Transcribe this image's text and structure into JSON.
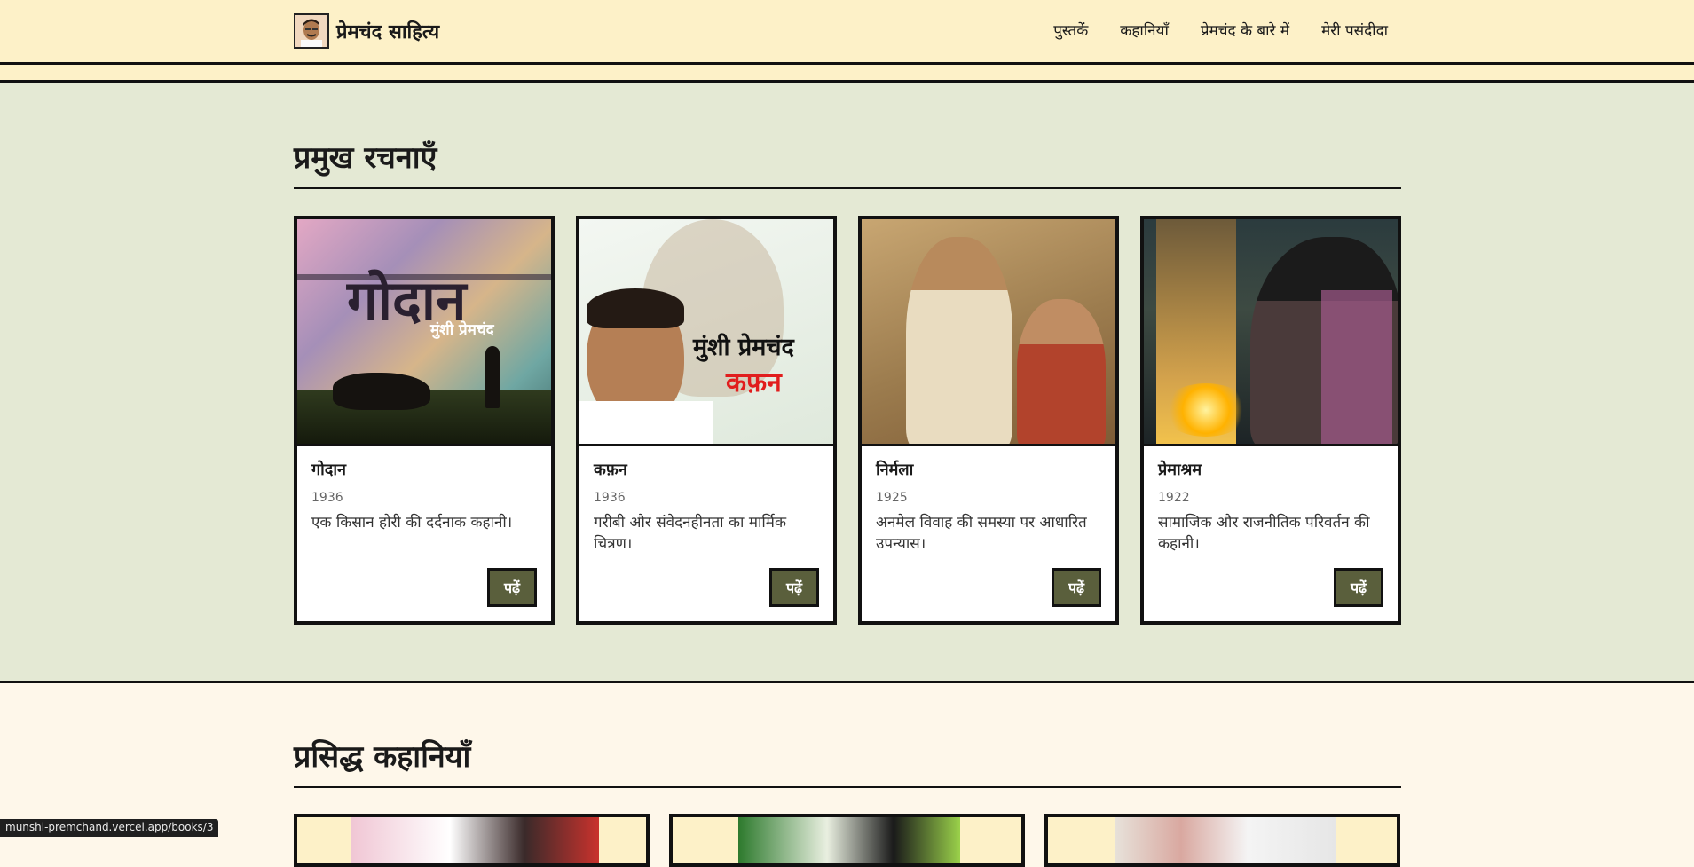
{
  "header": {
    "brand": "प्रेमचंद साहित्य",
    "nav": [
      "पुस्तकें",
      "कहानियाँ",
      "प्रेमचंद के बारे में",
      "मेरी पसंदीदा"
    ]
  },
  "works": {
    "heading": "प्रमुख रचनाएँ",
    "books": [
      {
        "title": "गोदान",
        "year": "1936",
        "desc": "एक किसान होरी की दर्दनाक कहानी।",
        "button": "पढ़ें",
        "cover_title": "गोदान",
        "cover_author": "मुंशी प्रेमचंद"
      },
      {
        "title": "कफ़न",
        "year": "1936",
        "desc": "गरीबी और संवेदनहीनता का मार्मिक चित्रण।",
        "button": "पढ़ें",
        "cover_title": "कफ़न",
        "cover_author": "मुंशी प्रेमचंद"
      },
      {
        "title": "निर्मला",
        "year": "1925",
        "desc": "अनमेल विवाह की समस्या पर आधारित उपन्यास।",
        "button": "पढ़ें"
      },
      {
        "title": "प्रेमाश्रम",
        "year": "1922",
        "desc": "सामाजिक और राजनीतिक परिवर्तन की कहानी।",
        "button": "पढ़ें"
      }
    ]
  },
  "stories": {
    "heading": "प्रसिद्ध कहानियाँ"
  },
  "status_bar": {
    "url": "munshi-premchand.vercel.app/books/3"
  },
  "colors": {
    "header_bg": "#fdf1c8",
    "works_bg": "#e4e9d4",
    "stories_bg": "#fef7ea",
    "button_bg": "#5a5f3c"
  }
}
